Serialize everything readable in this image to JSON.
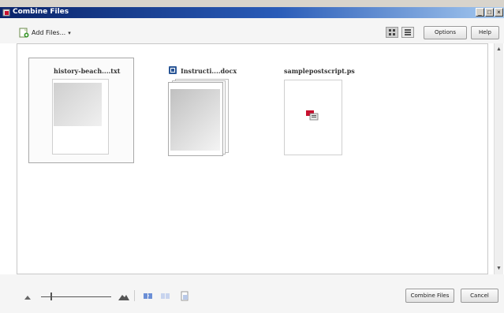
{
  "window": {
    "title": "Combine Files",
    "controls": {
      "minimize": "_",
      "restore": "□",
      "close": "×"
    }
  },
  "toolbar": {
    "add_files_label": "Add Files...",
    "add_files_caret": "▾",
    "options_label": "Options",
    "help_label": "Help",
    "view_modes": [
      "thumbnail-view-icon",
      "list-view-icon"
    ]
  },
  "files": [
    {
      "name": "history-beach....txt",
      "selected": true,
      "icon": "text-page-icon"
    },
    {
      "name": "Instructi....docx",
      "selected": false,
      "icon": "word-document-icon",
      "stacked_pages": true
    },
    {
      "name": "samplepostscript.ps",
      "selected": false,
      "icon": "postscript-file-icon"
    }
  ],
  "bottom": {
    "zoom_slider_value": 0.15,
    "combine_label": "Combine Files",
    "cancel_label": "Cancel",
    "tool_icons": [
      "small-mountain-icon",
      "large-mountain-icon",
      "expand-pages-icon",
      "collapse-pages-icon",
      "page-icon"
    ]
  },
  "colors": {
    "titlebar_start": "#0a246a",
    "titlebar_end": "#a6caf0",
    "word_blue": "#2b5797",
    "pdf_red": "#c8102e"
  }
}
